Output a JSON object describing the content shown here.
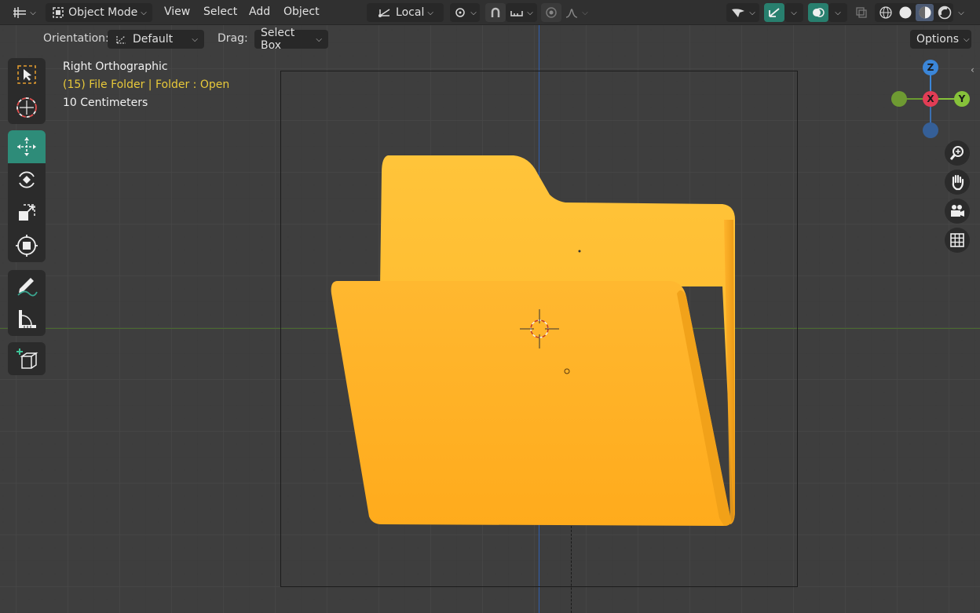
{
  "header": {
    "mode_label": "Object Mode",
    "menus": [
      "View",
      "Select",
      "Add",
      "Object"
    ],
    "pivot_label": "Local"
  },
  "tool_options": {
    "orientation_label": "Orientation:",
    "orientation_value": "Default",
    "drag_label": "Drag:",
    "drag_value": "Select Box",
    "options_label": "Options"
  },
  "overlay": {
    "view_name": "Right Orthographic",
    "object_info": "(15) File Folder | Folder : Open",
    "scale": "10 Centimeters"
  },
  "gizmo": {
    "z_label": "Z",
    "x_label": "X",
    "y_label": "Y"
  },
  "colors": {
    "folder_front": "#ffb12a",
    "folder_back": "#ffc230",
    "active_tool": "#2e8c79",
    "object_info_text": "#e8c93a",
    "axis_x": "#e23d55",
    "axis_y": "#86c23a",
    "axis_z": "#3b86d8"
  },
  "toolbar": {
    "tools": [
      "select-box",
      "cursor",
      "move",
      "rotate",
      "scale",
      "transform",
      "annotate",
      "measure",
      "add-cube"
    ],
    "active_tool": "move"
  }
}
